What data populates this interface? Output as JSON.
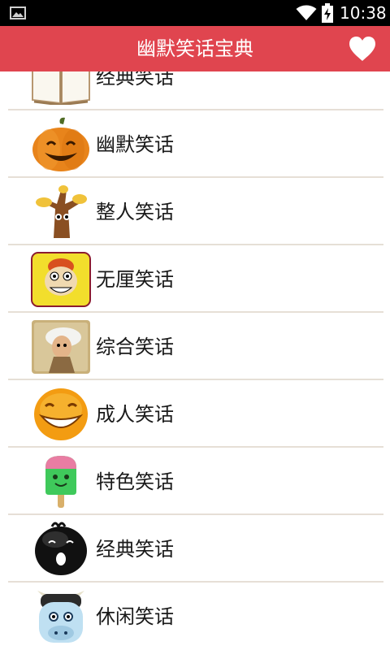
{
  "status_bar": {
    "time": "10:38"
  },
  "app_bar": {
    "title": "幽默笑话宝典",
    "favorite_icon": "heart-icon"
  },
  "categories": [
    {
      "label": "经典笑话",
      "icon": "book-icon"
    },
    {
      "label": "幽默笑话",
      "icon": "pumpkin-icon"
    },
    {
      "label": "整人笑话",
      "icon": "tree-stump-icon"
    },
    {
      "label": "无厘笑话",
      "icon": "monkey-icon"
    },
    {
      "label": "综合笑话",
      "icon": "old-man-icon"
    },
    {
      "label": "成人笑话",
      "icon": "grin-smiley-icon"
    },
    {
      "label": "特色笑话",
      "icon": "popsicle-icon"
    },
    {
      "label": "经典笑话",
      "icon": "black-face-icon"
    },
    {
      "label": "休闲笑话",
      "icon": "cow-icon"
    }
  ],
  "colors": {
    "app_bar": "#e0454f",
    "divider": "#e6dfd6"
  }
}
